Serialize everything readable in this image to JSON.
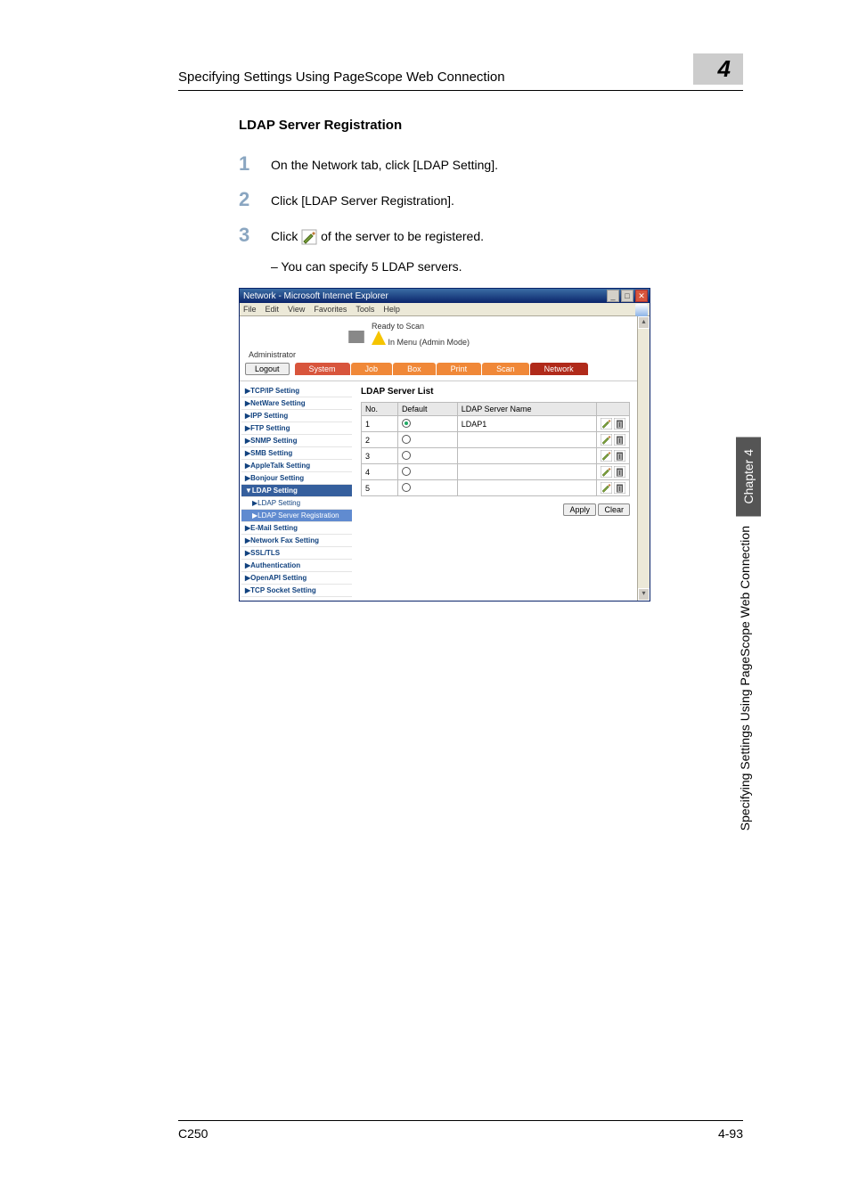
{
  "header": {
    "title": "Specifying Settings Using PageScope Web Connection",
    "chapter_num": "4"
  },
  "section_title": "LDAP Server Registration",
  "steps": {
    "s1": {
      "num": "1",
      "text": "On the Network tab, click [LDAP Setting]."
    },
    "s2": {
      "num": "2",
      "text": "Click [LDAP Server Registration]."
    },
    "s3": {
      "num": "3",
      "pre": "Click ",
      "post": " of the server to be registered."
    },
    "sub": "–   You can specify 5 LDAP servers."
  },
  "ie": {
    "title": "Network - Microsoft Internet Explorer",
    "menu": {
      "file": "File",
      "edit": "Edit",
      "view": "View",
      "favorites": "Favorites",
      "tools": "Tools",
      "help": "Help"
    },
    "status1": "Ready to Scan",
    "status2": "In Menu (Admin Mode)",
    "admin": "Administrator",
    "logout": "Logout",
    "tabs": {
      "system": "System",
      "job": "Job",
      "box": "Box",
      "print": "Print",
      "scan": "Scan",
      "network": "Network"
    },
    "side": {
      "tcpip": "▶TCP/IP Setting",
      "netware": "▶NetWare Setting",
      "ipp": "▶IPP Setting",
      "ftp": "▶FTP Setting",
      "snmp": "▶SNMP Setting",
      "smb": "▶SMB Setting",
      "appletalk": "▶AppleTalk Setting",
      "bonjour": "▶Bonjour Setting",
      "ldap_parent": "▼LDAP Setting",
      "ldap_setting": "▶LDAP Setting",
      "ldap_reg": "▶LDAP Server Registration",
      "email": "▶E-Mail Setting",
      "netfax": "▶Network Fax Setting",
      "ssl": "▶SSL/TLS",
      "auth": "▶Authentication",
      "openapi": "▶OpenAPI Setting",
      "tcpsocket": "▶TCP Socket Setting"
    },
    "main": {
      "title": "LDAP Server List",
      "cols": {
        "no": "No.",
        "default": "Default",
        "name": "LDAP Server Name"
      },
      "rows": [
        {
          "no": "1",
          "selected": true,
          "name": "LDAP1"
        },
        {
          "no": "2",
          "selected": false,
          "name": ""
        },
        {
          "no": "3",
          "selected": false,
          "name": ""
        },
        {
          "no": "4",
          "selected": false,
          "name": ""
        },
        {
          "no": "5",
          "selected": false,
          "name": ""
        }
      ],
      "apply": "Apply",
      "clear": "Clear"
    }
  },
  "vertical": {
    "label": "Specifying Settings Using PageScope Web Connection",
    "chapter": "Chapter 4"
  },
  "footer": {
    "left": "C250",
    "right": "4-93"
  }
}
